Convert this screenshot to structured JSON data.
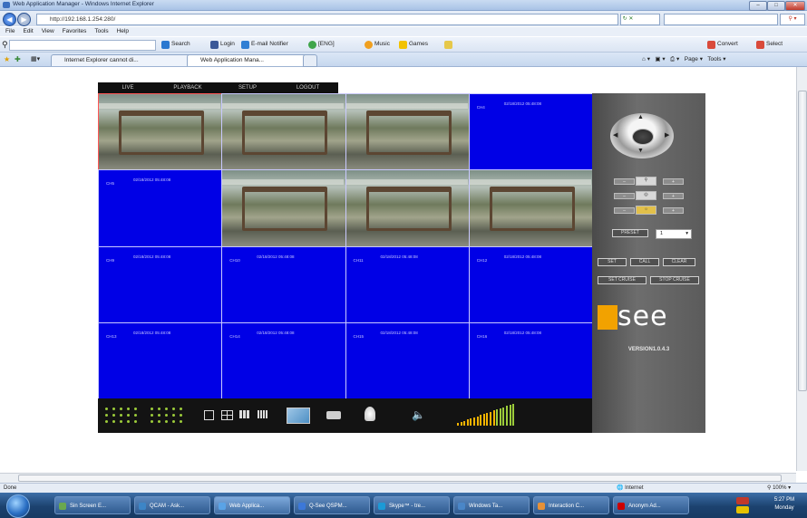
{
  "window": {
    "title": "Web Application Manager - Windows Internet Explorer"
  },
  "browser": {
    "url": "http://192.168.1.254:280/",
    "menu": [
      "File",
      "Edit",
      "View",
      "Favorites",
      "Tools",
      "Help"
    ],
    "toolbar": {
      "search": "Search",
      "login": "Login",
      "email": "E-mail Notifier",
      "weather": "[ENG]",
      "music": "Music",
      "games": "Games",
      "convert": "Convert",
      "select": "Select"
    },
    "tabs": [
      "Internet Explorer cannot di...",
      "Web Application Mana..."
    ],
    "commandbar": {
      "page": "Page",
      "tools": "Tools"
    }
  },
  "dvr": {
    "nav": [
      "LIVE",
      "PLAYBACK",
      "SETUP",
      "LOGOUT"
    ],
    "grid": [
      {
        "type": "cam",
        "label": "",
        "ts": ""
      },
      {
        "type": "cam",
        "label": "",
        "ts": ""
      },
      {
        "type": "cam",
        "label": "",
        "ts": ""
      },
      {
        "type": "blue",
        "label": "CH4",
        "ts": "02/18/2012 05:48:08"
      },
      {
        "type": "blue",
        "label": "CH5",
        "ts": "02/18/2012 05:48:08"
      },
      {
        "type": "cam",
        "label": "",
        "ts": ""
      },
      {
        "type": "cam",
        "label": "",
        "ts": ""
      },
      {
        "type": "cam",
        "label": "",
        "ts": ""
      },
      {
        "type": "blue",
        "label": "CH9",
        "ts": "02/18/2012 05:48:08"
      },
      {
        "type": "blue",
        "label": "CH10",
        "ts": "02/18/2012 05:48:08"
      },
      {
        "type": "blue",
        "label": "CH11",
        "ts": "02/18/2012 05:48:08"
      },
      {
        "type": "blue",
        "label": "CH12",
        "ts": "02/18/2012 05:48:08"
      },
      {
        "type": "blue",
        "label": "CH13",
        "ts": "02/18/2012 05:48:08"
      },
      {
        "type": "blue",
        "label": "CH14",
        "ts": "02/18/2012 05:48:08"
      },
      {
        "type": "blue",
        "label": "CH15",
        "ts": "02/18/2012 05:48:08"
      },
      {
        "type": "blue",
        "label": "CH16",
        "ts": "02/18/2012 05:48:08"
      }
    ],
    "preset_label": "PRESET",
    "preset_value": "1",
    "buttons": {
      "set": "SET",
      "call": "CALL",
      "clear": "CLEAR",
      "set_cruise": "SET CRUISE",
      "stop_cruise": "STOP CRUISE"
    },
    "logo": "QSEE",
    "version": "VERSION1.0.4.3"
  },
  "statusbar": {
    "left": "Done",
    "zone": "Internet",
    "zoom": "100%"
  },
  "taskbar": {
    "items": [
      "Sin Screen E...",
      "QCAM - Ask...",
      "Web Applica...",
      "Q-See QSPM...",
      "Skype™ - tre...",
      "Windows Ta...",
      "Interaction C...",
      "Anonym Ad..."
    ],
    "time": "5:27 PM",
    "day": "Monday"
  },
  "colors": {
    "grid_blue": "#0000e6",
    "accent_green": "#9ccc3a",
    "logo_orange": "#f2a200"
  }
}
